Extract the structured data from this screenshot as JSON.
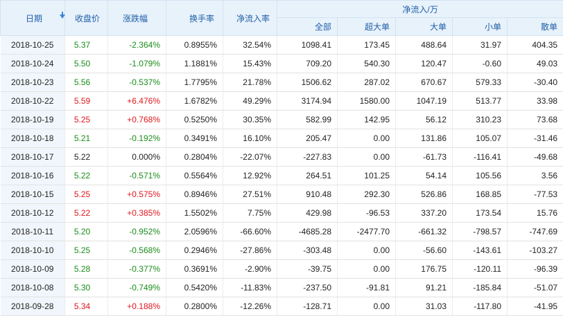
{
  "headers": {
    "date": "日期",
    "close": "收盘价",
    "change": "涨跌幅",
    "turnover": "换手率",
    "netflow_ratio": "净流入率",
    "netflow_group": "净流入/万",
    "total": "全部",
    "xl": "超大单",
    "large": "大单",
    "small": "小单",
    "retail": "散单"
  },
  "colors": {
    "up": "#e0161e",
    "down": "#1a8c1a",
    "header_bg": "#e8f2fb",
    "header_text": "#1f5fa8"
  },
  "icons": {
    "sort": "sort-down-arrow-icon"
  },
  "rows": [
    {
      "date": "2018-10-25",
      "close": "5.37",
      "change": "-2.364%",
      "turnover": "0.8955%",
      "ratio": "32.54%",
      "total": "1098.41",
      "xl": "173.45",
      "large": "488.64",
      "small": "31.97",
      "retail": "404.35",
      "dir": "down"
    },
    {
      "date": "2018-10-24",
      "close": "5.50",
      "change": "-1.079%",
      "turnover": "1.1881%",
      "ratio": "15.43%",
      "total": "709.20",
      "xl": "540.30",
      "large": "120.47",
      "small": "-0.60",
      "retail": "49.03",
      "dir": "down"
    },
    {
      "date": "2018-10-23",
      "close": "5.56",
      "change": "-0.537%",
      "turnover": "1.7795%",
      "ratio": "21.78%",
      "total": "1506.62",
      "xl": "287.02",
      "large": "670.67",
      "small": "579.33",
      "retail": "-30.40",
      "dir": "down"
    },
    {
      "date": "2018-10-22",
      "close": "5.59",
      "change": "+6.476%",
      "turnover": "1.6782%",
      "ratio": "49.29%",
      "total": "3174.94",
      "xl": "1580.00",
      "large": "1047.19",
      "small": "513.77",
      "retail": "33.98",
      "dir": "up"
    },
    {
      "date": "2018-10-19",
      "close": "5.25",
      "change": "+0.768%",
      "turnover": "0.5250%",
      "ratio": "30.35%",
      "total": "582.99",
      "xl": "142.95",
      "large": "56.12",
      "small": "310.23",
      "retail": "73.68",
      "dir": "up"
    },
    {
      "date": "2018-10-18",
      "close": "5.21",
      "change": "-0.192%",
      "turnover": "0.3491%",
      "ratio": "16.10%",
      "total": "205.47",
      "xl": "0.00",
      "large": "131.86",
      "small": "105.07",
      "retail": "-31.46",
      "dir": "down"
    },
    {
      "date": "2018-10-17",
      "close": "5.22",
      "change": "0.000%",
      "turnover": "0.2804%",
      "ratio": "-22.07%",
      "total": "-227.83",
      "xl": "0.00",
      "large": "-61.73",
      "small": "-116.41",
      "retail": "-49.68",
      "dir": "flat"
    },
    {
      "date": "2018-10-16",
      "close": "5.22",
      "change": "-0.571%",
      "turnover": "0.5564%",
      "ratio": "12.92%",
      "total": "264.51",
      "xl": "101.25",
      "large": "54.14",
      "small": "105.56",
      "retail": "3.56",
      "dir": "down"
    },
    {
      "date": "2018-10-15",
      "close": "5.25",
      "change": "+0.575%",
      "turnover": "0.8946%",
      "ratio": "27.51%",
      "total": "910.48",
      "xl": "292.30",
      "large": "526.86",
      "small": "168.85",
      "retail": "-77.53",
      "dir": "up"
    },
    {
      "date": "2018-10-12",
      "close": "5.22",
      "change": "+0.385%",
      "turnover": "1.5502%",
      "ratio": "7.75%",
      "total": "429.98",
      "xl": "-96.53",
      "large": "337.20",
      "small": "173.54",
      "retail": "15.76",
      "dir": "up"
    },
    {
      "date": "2018-10-11",
      "close": "5.20",
      "change": "-0.952%",
      "turnover": "2.0596%",
      "ratio": "-66.60%",
      "total": "-4685.28",
      "xl": "-2477.70",
      "large": "-661.32",
      "small": "-798.57",
      "retail": "-747.69",
      "dir": "down"
    },
    {
      "date": "2018-10-10",
      "close": "5.25",
      "change": "-0.568%",
      "turnover": "0.2946%",
      "ratio": "-27.86%",
      "total": "-303.48",
      "xl": "0.00",
      "large": "-56.60",
      "small": "-143.61",
      "retail": "-103.27",
      "dir": "down"
    },
    {
      "date": "2018-10-09",
      "close": "5.28",
      "change": "-0.377%",
      "turnover": "0.3691%",
      "ratio": "-2.90%",
      "total": "-39.75",
      "xl": "0.00",
      "large": "176.75",
      "small": "-120.11",
      "retail": "-96.39",
      "dir": "down"
    },
    {
      "date": "2018-10-08",
      "close": "5.30",
      "change": "-0.749%",
      "turnover": "0.5420%",
      "ratio": "-11.83%",
      "total": "-237.50",
      "xl": "-91.81",
      "large": "91.21",
      "small": "-185.84",
      "retail": "-51.07",
      "dir": "down"
    },
    {
      "date": "2018-09-28",
      "close": "5.34",
      "change": "+0.188%",
      "turnover": "0.2800%",
      "ratio": "-12.26%",
      "total": "-128.71",
      "xl": "0.00",
      "large": "31.03",
      "small": "-117.80",
      "retail": "-41.95",
      "dir": "up"
    }
  ]
}
